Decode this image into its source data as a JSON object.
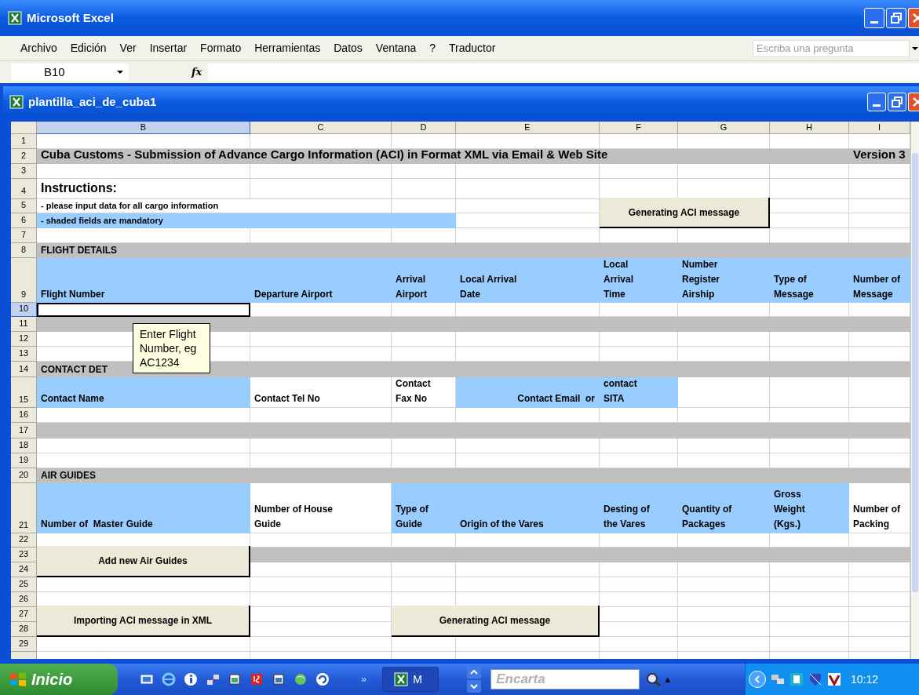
{
  "window": {
    "title": "Microsoft Excel"
  },
  "menu": [
    {
      "label": "Archivo"
    },
    {
      "label": "Edición"
    },
    {
      "label": "Ver"
    },
    {
      "label": "Insertar"
    },
    {
      "label": "Formato"
    },
    {
      "label": "Herramientas"
    },
    {
      "label": "Datos"
    },
    {
      "label": "Ventana"
    },
    {
      "label": "?"
    },
    {
      "label": "Traductor"
    }
  ],
  "help_field": {
    "placeholder": "Escriba una pregunta"
  },
  "formula_bar": {
    "name_box": "B10",
    "fx": "fx"
  },
  "workbook": {
    "title": "plantilla_aci_de_cuba1"
  },
  "columns": [
    {
      "letter": "B",
      "selected": true
    },
    {
      "letter": "C",
      "selected": false
    },
    {
      "letter": "D",
      "selected": false
    },
    {
      "letter": "E",
      "selected": false
    },
    {
      "letter": "F",
      "selected": false
    },
    {
      "letter": "G",
      "selected": false
    },
    {
      "letter": "H",
      "selected": false
    },
    {
      "letter": "I",
      "selected": false
    }
  ],
  "rows": [
    {
      "number": "1",
      "selected": false
    },
    {
      "number": "2",
      "selected": false,
      "color": "#c0c0c0",
      "cells": [
        {
          "kind": "title",
          "text": "Cuba Customs - Submission of Advance Cargo Information (ACI) in Format XML via Email & Web Site"
        }
      ],
      "last_cell": {
        "kind": "title",
        "text": "Version 3"
      }
    },
    {
      "number": "3",
      "selected": false
    },
    {
      "number": "4",
      "selected": false,
      "cells": [
        {
          "kind": "heading",
          "text": "Instructions:"
        }
      ]
    },
    {
      "number": "5",
      "selected": false,
      "cells": [
        {
          "kind": "note",
          "text": "- please input data for all cargo information"
        }
      ]
    },
    {
      "number": "6",
      "selected": false,
      "cells": [
        {
          "kind": "note",
          "color": "#99ccff",
          "text": "- shaded fields are mandatory"
        },
        {
          "color": "#99ccff"
        },
        {
          "color": "#99ccff"
        }
      ]
    },
    {
      "number": "7",
      "selected": false
    },
    {
      "number": "8",
      "selected": false,
      "color": "#c0c0c0",
      "cells": [
        {
          "kind": "section",
          "text": "FLIGHT DETAILS"
        }
      ]
    },
    {
      "number": "9",
      "selected": false,
      "color": "#99ccff",
      "cells": [
        {
          "kind": "label",
          "text": "Flight Number"
        },
        {
          "kind": "label",
          "text": "Departure Airport"
        },
        {
          "kind": "label",
          "text": "Arrival\nAirport"
        },
        {
          "kind": "label",
          "text": "Local Arrival\nDate"
        },
        {
          "kind": "label",
          "text": "Local\nArrival\nTime"
        },
        {
          "kind": "label",
          "text": "Number\nRegister\nAirship"
        },
        {
          "kind": "label",
          "text": "Type of\nMessage"
        },
        {
          "kind": "label",
          "text": "Number of\nMessage"
        }
      ]
    },
    {
      "number": "10",
      "selected": true
    },
    {
      "number": "11",
      "selected": false,
      "color": "#c0c0c0"
    },
    {
      "number": "12",
      "selected": false
    },
    {
      "number": "13",
      "selected": false
    },
    {
      "number": "14",
      "selected": false,
      "color": "#c0c0c0",
      "cells": [
        {
          "kind": "section",
          "text": "CONTACT DET"
        }
      ]
    },
    {
      "number": "15",
      "selected": false,
      "cells": [
        {
          "kind": "label",
          "color": "#99ccff",
          "text": "Contact Name"
        },
        {
          "kind": "label",
          "text": "Contact Tel No"
        },
        {
          "kind": "label",
          "text": "Contact\nFax No"
        },
        {
          "kind": "label_right",
          "color": "#99ccff",
          "text": "Contact Email  or"
        },
        {
          "kind": "label",
          "color": "#99ccff",
          "text": "contact\nSITA"
        }
      ]
    },
    {
      "number": "16",
      "selected": false
    },
    {
      "number": "17",
      "selected": false,
      "color": "#c0c0c0"
    },
    {
      "number": "18",
      "selected": false
    },
    {
      "number": "19",
      "selected": false
    },
    {
      "number": "20",
      "selected": false,
      "color": "#c0c0c0",
      "cells": [
        {
          "kind": "section",
          "text": "AIR GUIDES"
        }
      ]
    },
    {
      "number": "21",
      "selected": false,
      "cells": [
        {
          "kind": "label",
          "color": "#99ccff",
          "text": "Number of  Master Guide"
        },
        {
          "kind": "label",
          "text": "Number of House\nGuide"
        },
        {
          "kind": "label",
          "color": "#99ccff",
          "text": "Type of\nGuide"
        },
        {
          "kind": "label",
          "color": "#99ccff",
          "text": "Origin of the Vares"
        },
        {
          "kind": "label",
          "color": "#99ccff",
          "text": "Desting of\nthe Vares"
        },
        {
          "kind": "label",
          "color": "#99ccff",
          "text": "Quantity of\nPackages"
        },
        {
          "kind": "label",
          "color": "#99ccff",
          "text": "Gross\nWeight\n(Kgs.)"
        },
        {
          "kind": "label",
          "text": "Number of\nPacking"
        }
      ]
    },
    {
      "number": "22",
      "selected": false
    },
    {
      "number": "23",
      "selected": false,
      "color": "#c0c0c0"
    },
    {
      "number": "24",
      "selected": false
    },
    {
      "number": "25",
      "selected": false
    },
    {
      "number": "26",
      "selected": false
    },
    {
      "number": "27",
      "selected": false
    },
    {
      "number": "28",
      "selected": false
    },
    {
      "number": "29",
      "selected": false
    }
  ],
  "sheet_buttons": [
    "Generating ACI message",
    "Add new Air Guides",
    "Importing ACI message in XML",
    "Generating ACI message"
  ],
  "comment": {
    "text": "Enter Flight Number, eg AC1234"
  },
  "taskbar": {
    "start": "Inicio",
    "chevron": "»",
    "task": "M",
    "search": {
      "placeholder": "Encarta"
    },
    "tray_arrow": "▲",
    "clock": "10:12"
  }
}
